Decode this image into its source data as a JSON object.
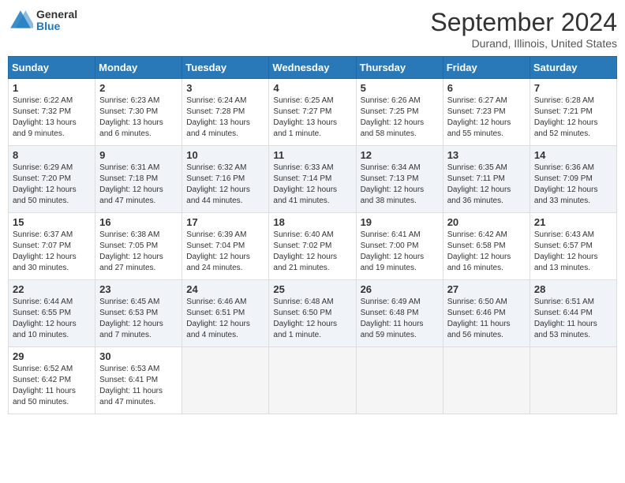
{
  "header": {
    "logo_line1": "General",
    "logo_line2": "Blue",
    "title": "September 2024",
    "subtitle": "Durand, Illinois, United States"
  },
  "days_of_week": [
    "Sunday",
    "Monday",
    "Tuesday",
    "Wednesday",
    "Thursday",
    "Friday",
    "Saturday"
  ],
  "weeks": [
    [
      {
        "day": 1,
        "info": "Sunrise: 6:22 AM\nSunset: 7:32 PM\nDaylight: 13 hours\nand 9 minutes."
      },
      {
        "day": 2,
        "info": "Sunrise: 6:23 AM\nSunset: 7:30 PM\nDaylight: 13 hours\nand 6 minutes."
      },
      {
        "day": 3,
        "info": "Sunrise: 6:24 AM\nSunset: 7:28 PM\nDaylight: 13 hours\nand 4 minutes."
      },
      {
        "day": 4,
        "info": "Sunrise: 6:25 AM\nSunset: 7:27 PM\nDaylight: 13 hours\nand 1 minute."
      },
      {
        "day": 5,
        "info": "Sunrise: 6:26 AM\nSunset: 7:25 PM\nDaylight: 12 hours\nand 58 minutes."
      },
      {
        "day": 6,
        "info": "Sunrise: 6:27 AM\nSunset: 7:23 PM\nDaylight: 12 hours\nand 55 minutes."
      },
      {
        "day": 7,
        "info": "Sunrise: 6:28 AM\nSunset: 7:21 PM\nDaylight: 12 hours\nand 52 minutes."
      }
    ],
    [
      {
        "day": 8,
        "info": "Sunrise: 6:29 AM\nSunset: 7:20 PM\nDaylight: 12 hours\nand 50 minutes."
      },
      {
        "day": 9,
        "info": "Sunrise: 6:31 AM\nSunset: 7:18 PM\nDaylight: 12 hours\nand 47 minutes."
      },
      {
        "day": 10,
        "info": "Sunrise: 6:32 AM\nSunset: 7:16 PM\nDaylight: 12 hours\nand 44 minutes."
      },
      {
        "day": 11,
        "info": "Sunrise: 6:33 AM\nSunset: 7:14 PM\nDaylight: 12 hours\nand 41 minutes."
      },
      {
        "day": 12,
        "info": "Sunrise: 6:34 AM\nSunset: 7:13 PM\nDaylight: 12 hours\nand 38 minutes."
      },
      {
        "day": 13,
        "info": "Sunrise: 6:35 AM\nSunset: 7:11 PM\nDaylight: 12 hours\nand 36 minutes."
      },
      {
        "day": 14,
        "info": "Sunrise: 6:36 AM\nSunset: 7:09 PM\nDaylight: 12 hours\nand 33 minutes."
      }
    ],
    [
      {
        "day": 15,
        "info": "Sunrise: 6:37 AM\nSunset: 7:07 PM\nDaylight: 12 hours\nand 30 minutes."
      },
      {
        "day": 16,
        "info": "Sunrise: 6:38 AM\nSunset: 7:05 PM\nDaylight: 12 hours\nand 27 minutes."
      },
      {
        "day": 17,
        "info": "Sunrise: 6:39 AM\nSunset: 7:04 PM\nDaylight: 12 hours\nand 24 minutes."
      },
      {
        "day": 18,
        "info": "Sunrise: 6:40 AM\nSunset: 7:02 PM\nDaylight: 12 hours\nand 21 minutes."
      },
      {
        "day": 19,
        "info": "Sunrise: 6:41 AM\nSunset: 7:00 PM\nDaylight: 12 hours\nand 19 minutes."
      },
      {
        "day": 20,
        "info": "Sunrise: 6:42 AM\nSunset: 6:58 PM\nDaylight: 12 hours\nand 16 minutes."
      },
      {
        "day": 21,
        "info": "Sunrise: 6:43 AM\nSunset: 6:57 PM\nDaylight: 12 hours\nand 13 minutes."
      }
    ],
    [
      {
        "day": 22,
        "info": "Sunrise: 6:44 AM\nSunset: 6:55 PM\nDaylight: 12 hours\nand 10 minutes."
      },
      {
        "day": 23,
        "info": "Sunrise: 6:45 AM\nSunset: 6:53 PM\nDaylight: 12 hours\nand 7 minutes."
      },
      {
        "day": 24,
        "info": "Sunrise: 6:46 AM\nSunset: 6:51 PM\nDaylight: 12 hours\nand 4 minutes."
      },
      {
        "day": 25,
        "info": "Sunrise: 6:48 AM\nSunset: 6:50 PM\nDaylight: 12 hours\nand 1 minute."
      },
      {
        "day": 26,
        "info": "Sunrise: 6:49 AM\nSunset: 6:48 PM\nDaylight: 11 hours\nand 59 minutes."
      },
      {
        "day": 27,
        "info": "Sunrise: 6:50 AM\nSunset: 6:46 PM\nDaylight: 11 hours\nand 56 minutes."
      },
      {
        "day": 28,
        "info": "Sunrise: 6:51 AM\nSunset: 6:44 PM\nDaylight: 11 hours\nand 53 minutes."
      }
    ],
    [
      {
        "day": 29,
        "info": "Sunrise: 6:52 AM\nSunset: 6:42 PM\nDaylight: 11 hours\nand 50 minutes."
      },
      {
        "day": 30,
        "info": "Sunrise: 6:53 AM\nSunset: 6:41 PM\nDaylight: 11 hours\nand 47 minutes."
      },
      {
        "day": null,
        "info": ""
      },
      {
        "day": null,
        "info": ""
      },
      {
        "day": null,
        "info": ""
      },
      {
        "day": null,
        "info": ""
      },
      {
        "day": null,
        "info": ""
      }
    ]
  ]
}
